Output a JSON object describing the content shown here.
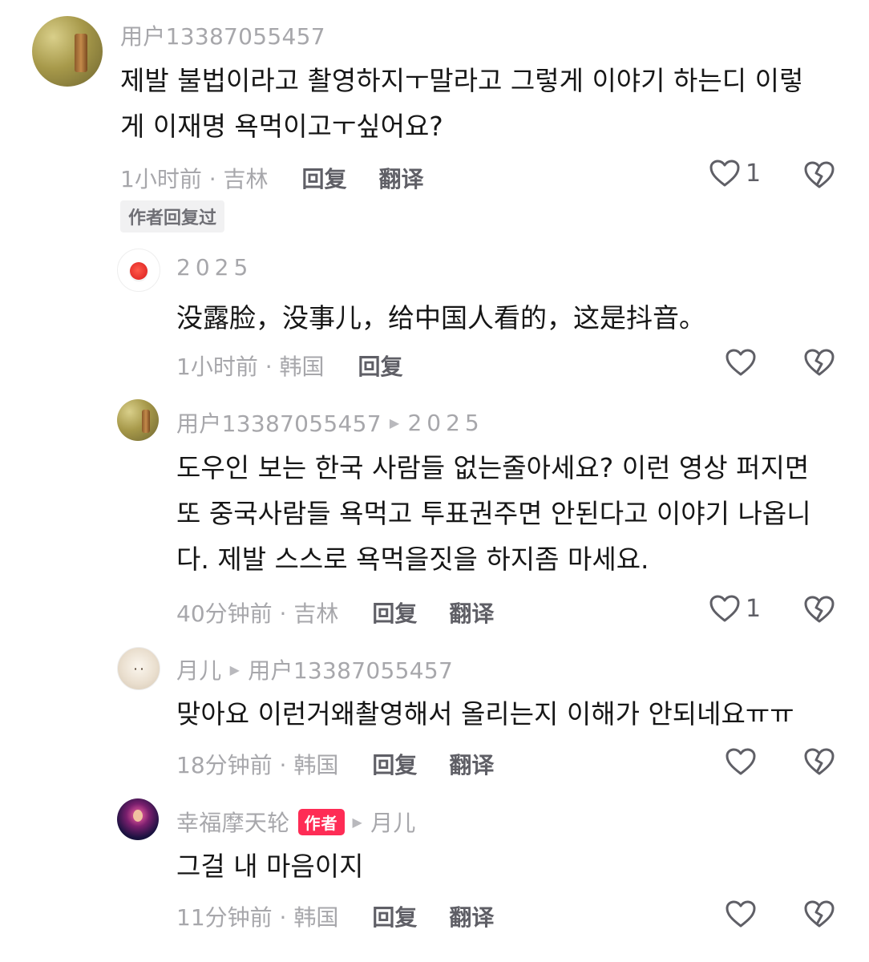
{
  "comment": {
    "username": "用户13387055457",
    "text": "제발 불법이라고 촬영하지ㅜ말라고 그렇게 이야기 하는디 이렇\n게 이재명 욕먹이고ㅜ싶어요?",
    "time_location": "1小时前 · 吉林",
    "reply_label": "回复",
    "translate_label": "翻译",
    "like_count": "1",
    "author_replied_badge": "作者回复过"
  },
  "replies": [
    {
      "username": "2025",
      "text": "没露脸，没事儿，给中国人看的，这是抖音。",
      "time_location": "1小时前 · 韩国",
      "reply_label": "回复"
    },
    {
      "username": "用户13387055457",
      "reply_to": "2025",
      "text": "도우인 보는 한국 사람들 없는줄아세요? 이런 영상 퍼지면\n또 중국사람들 욕먹고 투표권주면 안된다고 이야기 나옵니\n다. 제발 스스로 욕먹을짓을 하지좀 마세요.",
      "time_location": "40分钟前 · 吉林",
      "reply_label": "回复",
      "translate_label": "翻译",
      "like_count": "1"
    },
    {
      "username": "月儿",
      "reply_to": "用户13387055457",
      "text": "맞아요 이런거왜촬영해서 올리는지 이해가 안되네요ㅠㅠ",
      "time_location": "18分钟前 · 韩国",
      "reply_label": "回复",
      "translate_label": "翻译"
    },
    {
      "username": "幸福摩天轮",
      "author_badge": "作者",
      "reply_to": "月儿",
      "text": "그걸 내 마음이지",
      "time_location": "11分钟前 · 韩国",
      "reply_label": "回复",
      "translate_label": "翻译"
    }
  ],
  "colors": {
    "accent": "#fe2c55",
    "meta_gray": "#a7a7ab",
    "action_gray": "#5f5f66",
    "text": "#161616"
  },
  "icons": [
    "heart-outline-icon",
    "broken-heart-icon",
    "play-triangle-icon"
  ]
}
